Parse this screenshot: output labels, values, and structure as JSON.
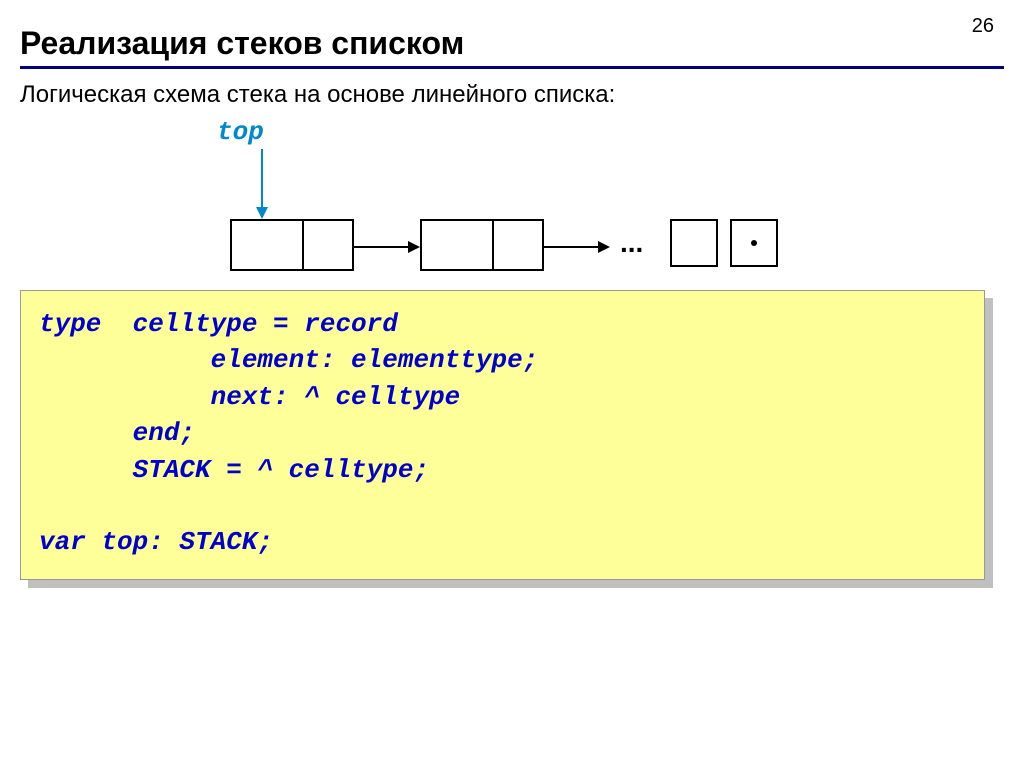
{
  "page_number": "26",
  "title": "Реализация стеков списком",
  "subtitle": "Логическая схема стека на основе линейного списка:",
  "diagram": {
    "top_label": "top",
    "ellipsis": "..."
  },
  "code": "type  celltype = record\n           element: elementtype;\n           next: ^ celltype\n      end;\n      STACK = ^ celltype;\n\nvar top: STACK;"
}
